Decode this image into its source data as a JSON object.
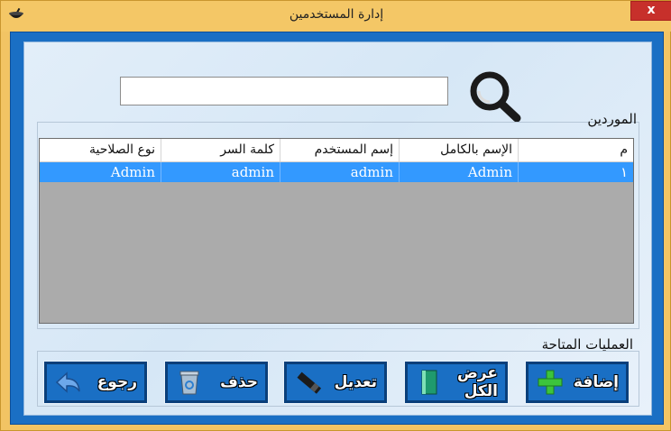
{
  "window": {
    "title": "إدارة المستخدمين",
    "close_label": "x"
  },
  "search": {
    "value": "",
    "placeholder": ""
  },
  "users_group": {
    "title": "الموردين"
  },
  "grid": {
    "headers": {
      "num": "م",
      "full_name": "الإسم بالكامل",
      "username": "إسم المستخدم",
      "password": "كلمة السر",
      "role": "نوع الصلاحية"
    },
    "rows": [
      {
        "num": "١",
        "full_name": "Admin",
        "username": "admin",
        "password": "admin",
        "role": "Admin"
      }
    ]
  },
  "operations": {
    "title": "العمليات المتاحة",
    "add_label": "إضافة",
    "view_all_label": "عرض الكل",
    "edit_label": "تعديل",
    "delete_label": "حذف",
    "back_label": "رجوع"
  },
  "colors": {
    "titlebar": "#f4c766",
    "frame": "#1a6fc4",
    "selection": "#3399ff",
    "close": "#c7302b"
  },
  "icons": [
    "app-icon",
    "search-icon",
    "plus-icon",
    "book-icon",
    "pen-icon",
    "recycle-bin-icon",
    "back-arrow-icon"
  ]
}
